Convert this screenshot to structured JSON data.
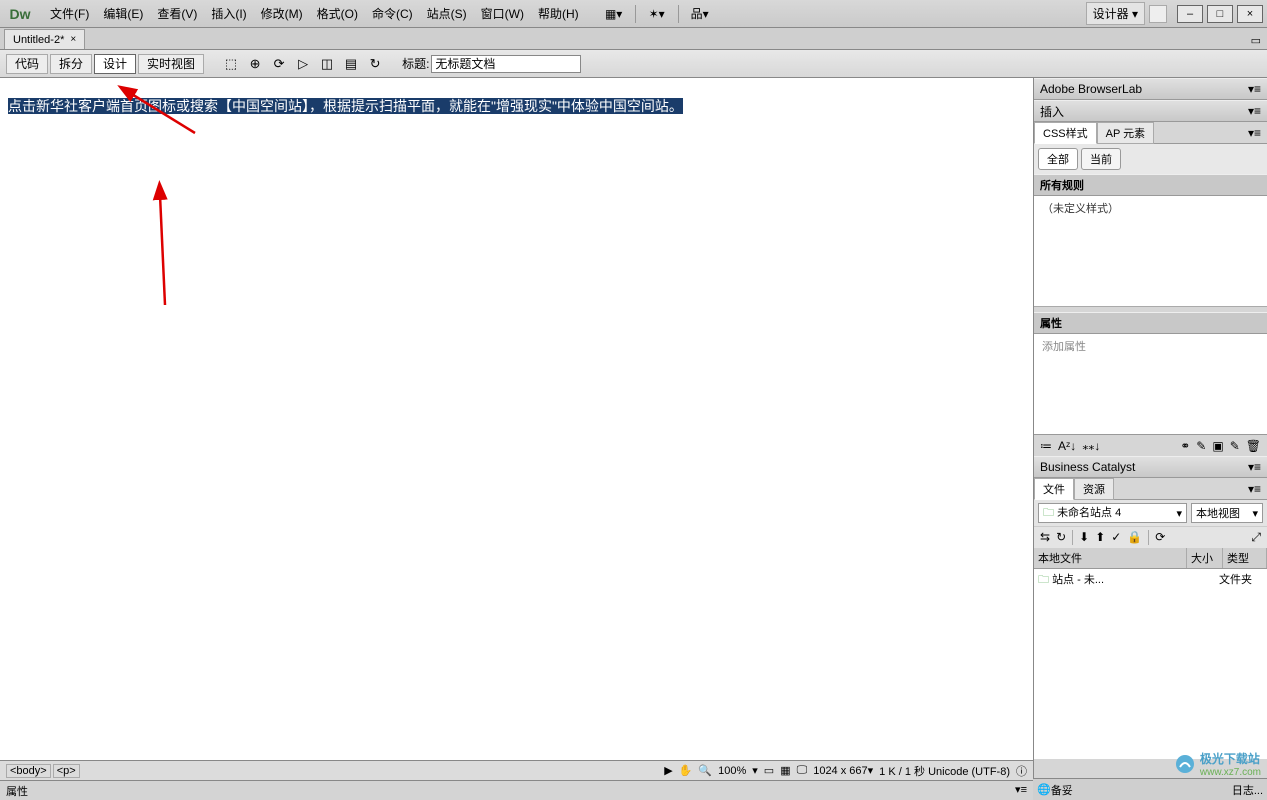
{
  "menubar": {
    "items": [
      "文件(F)",
      "编辑(E)",
      "查看(V)",
      "插入(I)",
      "修改(M)",
      "格式(O)",
      "命令(C)",
      "站点(S)",
      "窗口(W)",
      "帮助(H)"
    ]
  },
  "titlebar": {
    "designer": "设计器",
    "logo": "Dw"
  },
  "window_buttons": {
    "min": "–",
    "max": "□",
    "close": "×"
  },
  "doc_tab": {
    "name": "Untitled-2*",
    "close": "×"
  },
  "viewbar": {
    "code": "代码",
    "split": "拆分",
    "design": "设计",
    "live": "实时视图",
    "title_label": "标题:",
    "title_value": "无标题文档"
  },
  "content": {
    "text": "点击新华社客户端首页图标或搜索【中国空间站】，根据提示扫描平面，就能在\"增强现实\"中体验中国空间站。"
  },
  "status": {
    "breadcrumb": [
      "<body>",
      "<p>"
    ],
    "zoom": "100%",
    "dims": "1024 x 667",
    "size": "1 K / 1 秒 Unicode (UTF-8)"
  },
  "props_bar": {
    "label": "属性"
  },
  "panels": {
    "browserlab": "Adobe BrowserLab",
    "insert": "插入",
    "css_tabs": [
      "CSS样式",
      "AP 元素"
    ],
    "css_pills": [
      "全部",
      "当前"
    ],
    "rules_header": "所有规则",
    "no_rules": "（未定义样式）",
    "props_header": "属性",
    "add_prop": "添加属性",
    "bc": "Business Catalyst",
    "file_tabs": [
      "文件",
      "资源"
    ],
    "site_name": "未命名站点 4",
    "view_mode": "本地视图",
    "file_cols": [
      "本地文件",
      "大小",
      "类型"
    ],
    "file_row": {
      "name": "站点 - 未...",
      "type": "文件夹"
    }
  },
  "footer": {
    "ready": "备妥",
    "log": "日志..."
  },
  "watermark": {
    "text": "极光下载站",
    "url": "www.xz7.com"
  }
}
